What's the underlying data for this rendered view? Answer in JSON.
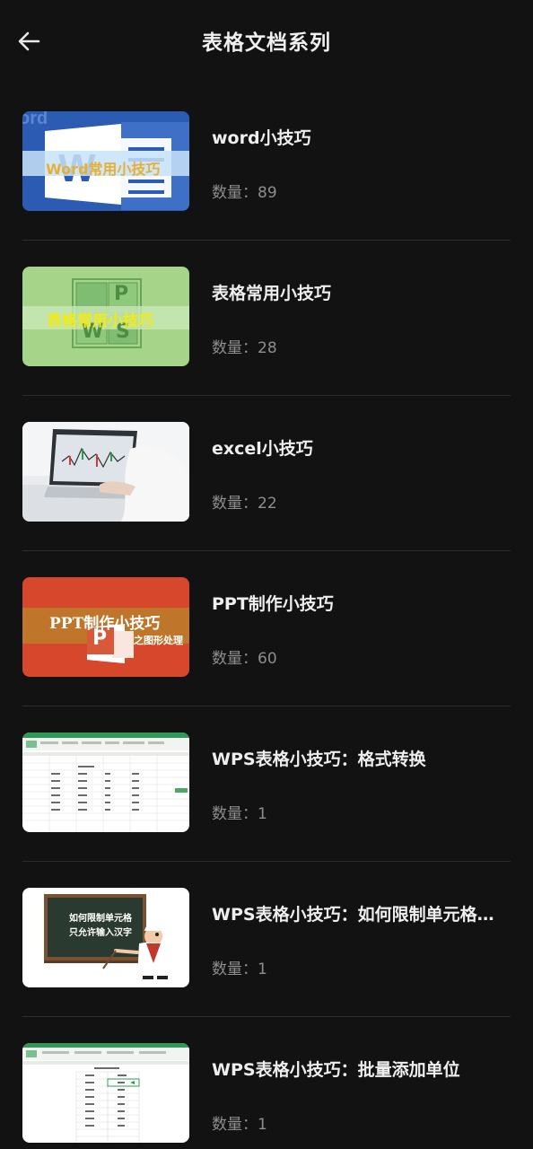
{
  "header": {
    "title": "表格文档系列",
    "back_icon": "arrow-left-icon"
  },
  "colors": {
    "background": "#121212",
    "title_text": "#eeeeee",
    "count_text": "#8e8e8e",
    "divider": "#2c2c2c"
  },
  "items": [
    {
      "title": "word小技巧",
      "count_text": "数量：89",
      "thumb": {
        "banner": "Word常用小技巧",
        "watermark": "ord"
      }
    },
    {
      "title": "表格常用小技巧",
      "count_text": "数量：28",
      "thumb": {
        "banner": "表格常用小技巧",
        "logo": [
          "P",
          "W",
          "S"
        ]
      }
    },
    {
      "title": "excel小技巧",
      "count_text": "数量：22",
      "thumb": {}
    },
    {
      "title": "PPT制作小技巧",
      "count_text": "数量：60",
      "thumb": {
        "banner": "PPT制作小技巧",
        "sub": "之图形处理",
        "logo": "P"
      }
    },
    {
      "title": "WPS表格小技巧：格式转换",
      "count_text": "数量：1",
      "thumb": {}
    },
    {
      "title": "WPS表格小技巧：如何限制单元格只允许输入汉字",
      "count_text": "数量：1",
      "thumb": {
        "board_line1": "如何限制单元格",
        "board_line2": "只允许输入汉字"
      }
    },
    {
      "title": "WPS表格小技巧：批量添加单位",
      "count_text": "数量：1",
      "thumb": {}
    }
  ]
}
